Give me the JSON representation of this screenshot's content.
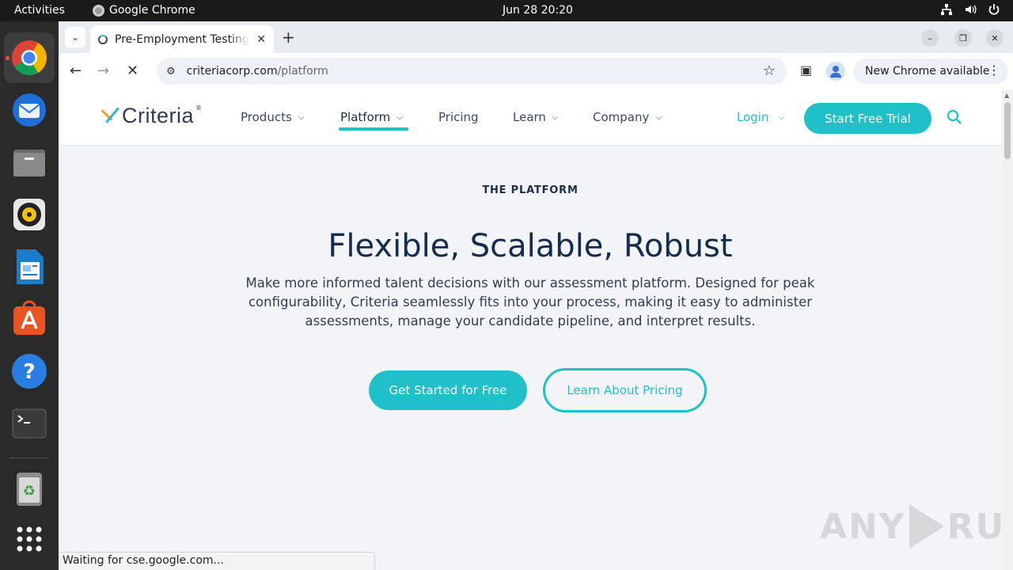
{
  "system": {
    "activities": "Activities",
    "app_name": "Google Chrome",
    "clock": "Jun 28  20:20",
    "tray": [
      "network-icon",
      "volume-icon",
      "power-icon"
    ]
  },
  "dock": {
    "items": [
      "chrome",
      "thunderbird",
      "files",
      "rhythmbox",
      "writer",
      "app-center",
      "help",
      "terminal",
      "trash",
      "app-grid"
    ]
  },
  "browser": {
    "tab_title": "Pre-Employment Testing",
    "url_host": "criteriacorp.com",
    "url_path": "/platform",
    "update_chip": "New Chrome available",
    "status_text": "Waiting for cse.google.com..."
  },
  "site": {
    "brand": "Criteria",
    "nav": [
      {
        "label": "Products"
      },
      {
        "label": "Platform"
      },
      {
        "label": "Pricing"
      },
      {
        "label": "Learn"
      },
      {
        "label": "Company"
      }
    ],
    "login": "Login",
    "trial_button": "Start Free Trial",
    "accent_color": "#1fc0c8"
  },
  "hero": {
    "eyebrow": "THE PLATFORM",
    "headline": "Flexible, Scalable, Robust",
    "body": "Make more informed talent decisions with our assessment platform. Designed for peak configurability, Criteria seamlessly fits into your process, making it easy to administer assessments, manage your candidate pipeline, and interpret results.",
    "cta_primary": "Get Started for Free",
    "cta_secondary": "Learn About Pricing"
  },
  "watermark": {
    "left": "ANY",
    "right": "RUN"
  }
}
